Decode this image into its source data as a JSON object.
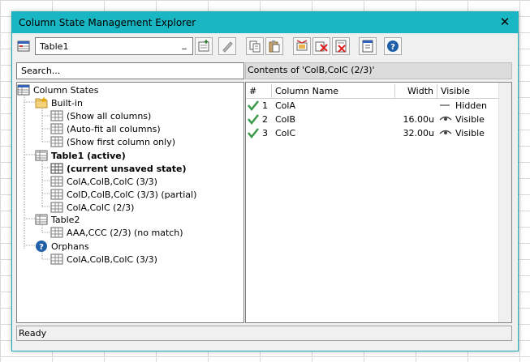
{
  "window": {
    "title": "Column State Management Explorer"
  },
  "toolbar": {
    "table_select_value": "Table1",
    "buttons": [
      "add-state-icon",
      "edit-state-icon",
      "copy-icon",
      "paste-icon",
      "rename-icon",
      "delete-icon",
      "delete-all-icon",
      "properties-icon",
      "help-icon"
    ]
  },
  "search": {
    "placeholder": "Search..."
  },
  "contents_label": "Contents of 'ColB,ColC (2/3)'",
  "tree": {
    "root": "Column States",
    "builtin": "Built-in",
    "builtin_items": [
      "(Show all columns)",
      "(Auto-fit all columns)",
      "(Show first column only)"
    ],
    "table1": "Table1 (active)",
    "table1_items": [
      "(current unsaved state)",
      "ColA,ColB,ColC (3/3)",
      "ColD,ColB,ColC (3/3) (partial)",
      "ColA,ColC (2/3)"
    ],
    "table2": "Table2",
    "table2_items": [
      "AAA,CCC (2/3) (no match)"
    ],
    "orphans": "Orphans",
    "orphans_items": [
      "ColA,ColB,ColC (3/3)"
    ]
  },
  "columns_list": {
    "headers": {
      "num": "#",
      "name": "Column Name",
      "width": "Width",
      "visible": "Visible"
    },
    "rows": [
      {
        "num": "1",
        "name": "ColA",
        "width": "",
        "visible": "Hidden",
        "visible_icon": "dash-icon"
      },
      {
        "num": "2",
        "name": "ColB",
        "width": "16.00u",
        "visible": "Visible",
        "visible_icon": "eye-icon"
      },
      {
        "num": "3",
        "name": "ColC",
        "width": "32.00u",
        "visible": "Visible",
        "visible_icon": "eye-icon"
      }
    ]
  },
  "status": "Ready",
  "colors": {
    "titlebar": "#19b6c4",
    "check": "#3a9a49",
    "help": "#1e5fa8"
  }
}
